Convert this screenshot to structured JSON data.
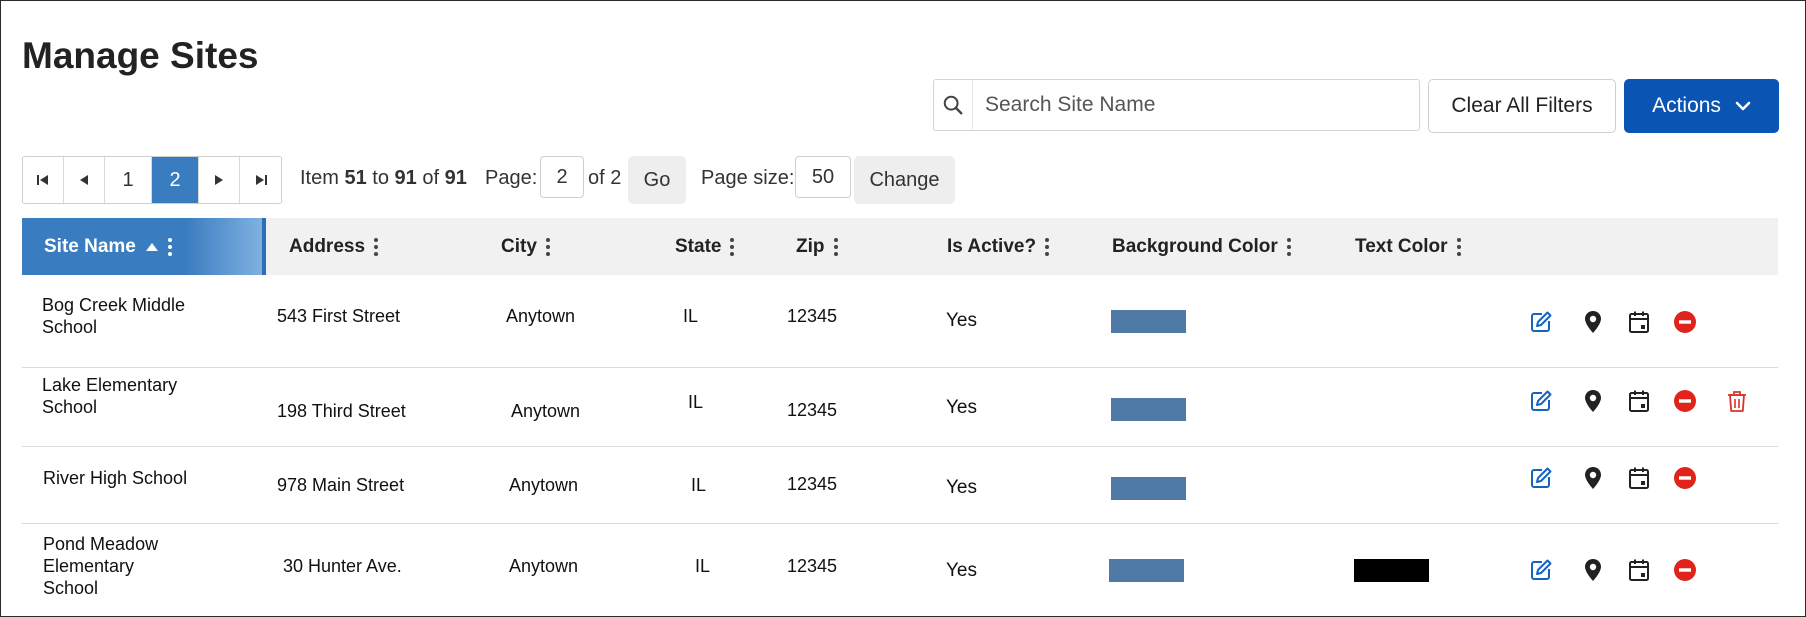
{
  "page": {
    "title": "Manage Sites"
  },
  "search": {
    "placeholder": "Search Site Name",
    "value": ""
  },
  "toolbar": {
    "clear_filters_label": "Clear All Filters",
    "actions_label": "Actions"
  },
  "pager": {
    "pages": [
      "1",
      "2"
    ],
    "current_page": "2",
    "item_label": "Item",
    "item_from": "51",
    "item_to_label": "to",
    "item_to": "91",
    "item_of_label": "of",
    "item_total": "91",
    "page_label": "Page:",
    "page_value": "2",
    "page_of_label": "of 2",
    "go_label": "Go",
    "page_size_label": "Page size:",
    "page_size_value": "50",
    "change_label": "Change"
  },
  "grid": {
    "columns": [
      "Site Name",
      "Address",
      "City",
      "State",
      "Zip",
      "Is Active?",
      "Background Color",
      "Text Color"
    ],
    "sort": {
      "column": "Site Name",
      "direction": "ascending"
    },
    "rows": [
      {
        "name": "Bog Creek Middle School",
        "address": "543 First Street",
        "city": "Anytown",
        "state": "IL",
        "zip": "12345",
        "active": "Yes",
        "bg_color": "#4f7aa8",
        "text_color": null,
        "has_delete": false
      },
      {
        "name": "Lake Elementary School",
        "address": "198 Third Street",
        "city": "Anytown",
        "state": "IL",
        "zip": "12345",
        "active": "Yes",
        "bg_color": "#4f7aa8",
        "text_color": null,
        "has_delete": true
      },
      {
        "name": "River High School",
        "address": "978 Main Street",
        "city": "Anytown",
        "state": "IL",
        "zip": "12345",
        "active": "Yes",
        "bg_color": "#4f7aa8",
        "text_color": null,
        "has_delete": false
      },
      {
        "name": "Pond Meadow Elementary School",
        "address": "30 Hunter Ave.",
        "city": "Anytown",
        "state": "IL",
        "zip": "12345",
        "active": "Yes",
        "bg_color": "#4f7aa8",
        "text_color": "#000000",
        "has_delete": false
      }
    ],
    "row_actions": [
      "edit-icon",
      "map-pin-icon",
      "calendar-icon",
      "deactivate-icon",
      "trash-icon"
    ]
  },
  "colors": {
    "primary": "#0a55b4",
    "header_sorted": "#3a7cc0",
    "action_blue": "#1565c0",
    "danger": "#e0241b",
    "trash": "#d9342b"
  }
}
